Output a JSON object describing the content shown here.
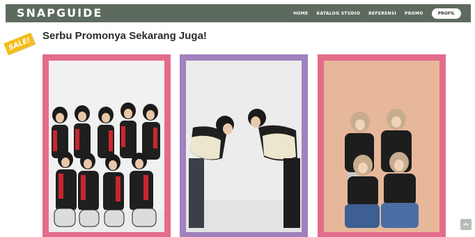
{
  "brand": {
    "logo_text": "SNAPGUIDE",
    "nav_color": "#5d6b5f"
  },
  "nav": {
    "items": [
      {
        "label": "HOME"
      },
      {
        "label": "KATALOG STUDIO"
      },
      {
        "label": "REFERENSI"
      },
      {
        "label": "PROMO"
      }
    ],
    "profile_label": "PROFIL"
  },
  "sale_badge": {
    "text": "SALE!",
    "color": "#f2be1e"
  },
  "section": {
    "title": "Serbu Promonya Sekarang Juga!"
  },
  "promos": [
    {
      "frame_color": "#e36c8b",
      "photo_bg": "#f1f1f1",
      "watermark": ""
    },
    {
      "frame_color": "#a181bd",
      "photo_bg": "#ececec",
      "watermark": ""
    },
    {
      "frame_color": "#e36c8b",
      "photo_bg": "#e7b79a",
      "watermark": ""
    }
  ],
  "icons": {
    "scroll_top": "chevron-up-icon"
  }
}
